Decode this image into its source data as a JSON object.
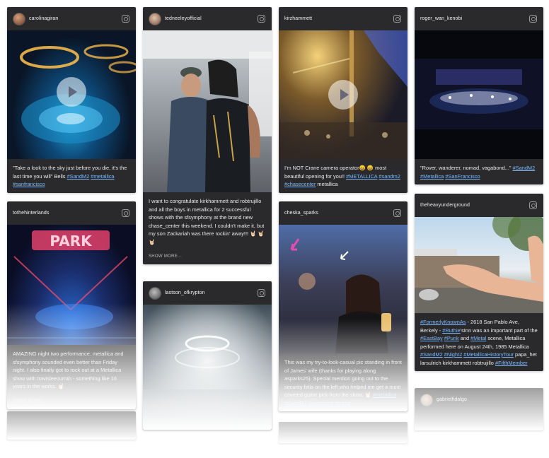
{
  "colors": {
    "card_bg": "#2a2a2c",
    "hashtag": "#7ab8ff",
    "caption_text": "#eaeaea"
  },
  "icons": {
    "post_icon": "instagram-icon",
    "play": "play-icon"
  },
  "posts": [
    {
      "user": "carolinagiran",
      "caption_pre": "\"Take a look to the sky just before you die, it's the last time you will\" Bells ",
      "tags": [
        "#SandM2",
        "#metallica",
        "#sanfrancisco"
      ]
    },
    {
      "user": "tedneeleyofficial",
      "caption": "I want to congratulate kirkhammett and robtrujillo and all the boys in metallica for 2 successful shows with the sfsymphony at the brand new chase_center this weekend. I couldn't make it, but my son Zackariah was there rockin' away!!! 🤘🏻 🤘🏻 🤘🏻",
      "show_more": "SHOW MORE..."
    },
    {
      "user": "kirzhammett",
      "caption_pre": "I'm NOT Crane camera operator😄 😄 most beautiful opening for you!! ",
      "tags": [
        "#METALLICA",
        "#sandm2",
        "#chasecenter"
      ],
      "caption_post": " metallica"
    },
    {
      "user": "roger_wan_kenobi",
      "caption_pre": "\"Rover, wanderer, nomad, vagabond...\" ",
      "tags": [
        "#SandM2",
        "#Metallica",
        "#SanFrancisco"
      ]
    },
    {
      "user": "tothehinterlands",
      "caption": "AMAZING night two performance. metallica and sfsymphony sounded even better than Friday night. I also finally got to rock out at a Metallica show with travisleecurrah - something like 16 years in the works. 🤘🏻",
      "show_more": "SHOW MORE..."
    },
    {
      "user": "lastson_ofkrypton"
    },
    {
      "user": "cheska_sparks",
      "caption_pre": "This was my try-to-look-casual pic standing in front of James' wife (thanks for playing along asparks25). Special mention going out to the security fella on the left who helped me get a most coveted guitar pick from the show. 🤘🏻 ",
      "tags": [
        "#metallica",
        "#SandM2",
        "#guitarpick",
        "#metal"
      ]
    },
    {
      "user": "theheavyunderground",
      "caption_parts": [
        "#FormerlyKnownAs",
        " - 2618 San Pablo Ave, Berkely - ",
        "#Ruthie",
        "'sInn was an important part of the ",
        "#EastBay",
        " ",
        "#Punk",
        " and ",
        "#Metal",
        " scene, Metallica performed here on August 24th, 1985 Metallica ",
        "#SandM2",
        " ",
        "#Night2",
        " ",
        "#MetallicaHistoryTour",
        " papa_het larsulrich kirkhammett robtrujillo ",
        "#FifthMember"
      ]
    },
    {
      "user": "gabrielfidalgo"
    },
    {
      "user": "..."
    }
  ]
}
